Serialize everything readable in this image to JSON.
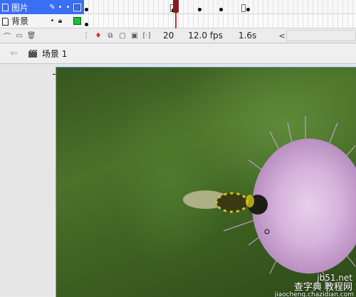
{
  "layers": [
    {
      "name": "图片",
      "selected": true,
      "color": "#3a6ff5"
    },
    {
      "name": "背景",
      "selected": false,
      "color": "#17c23b"
    }
  ],
  "timeline": {
    "current_frame": "20",
    "fps": "12.0 fps",
    "elapsed": "1.6s",
    "playhead_color": "#c9312f"
  },
  "edit_bar": {
    "scene": "场景 1"
  },
  "watermark": {
    "domain": "jb51.net",
    "site": "查字典 教程网",
    "url": "jiaocheng.chazidian.com"
  }
}
